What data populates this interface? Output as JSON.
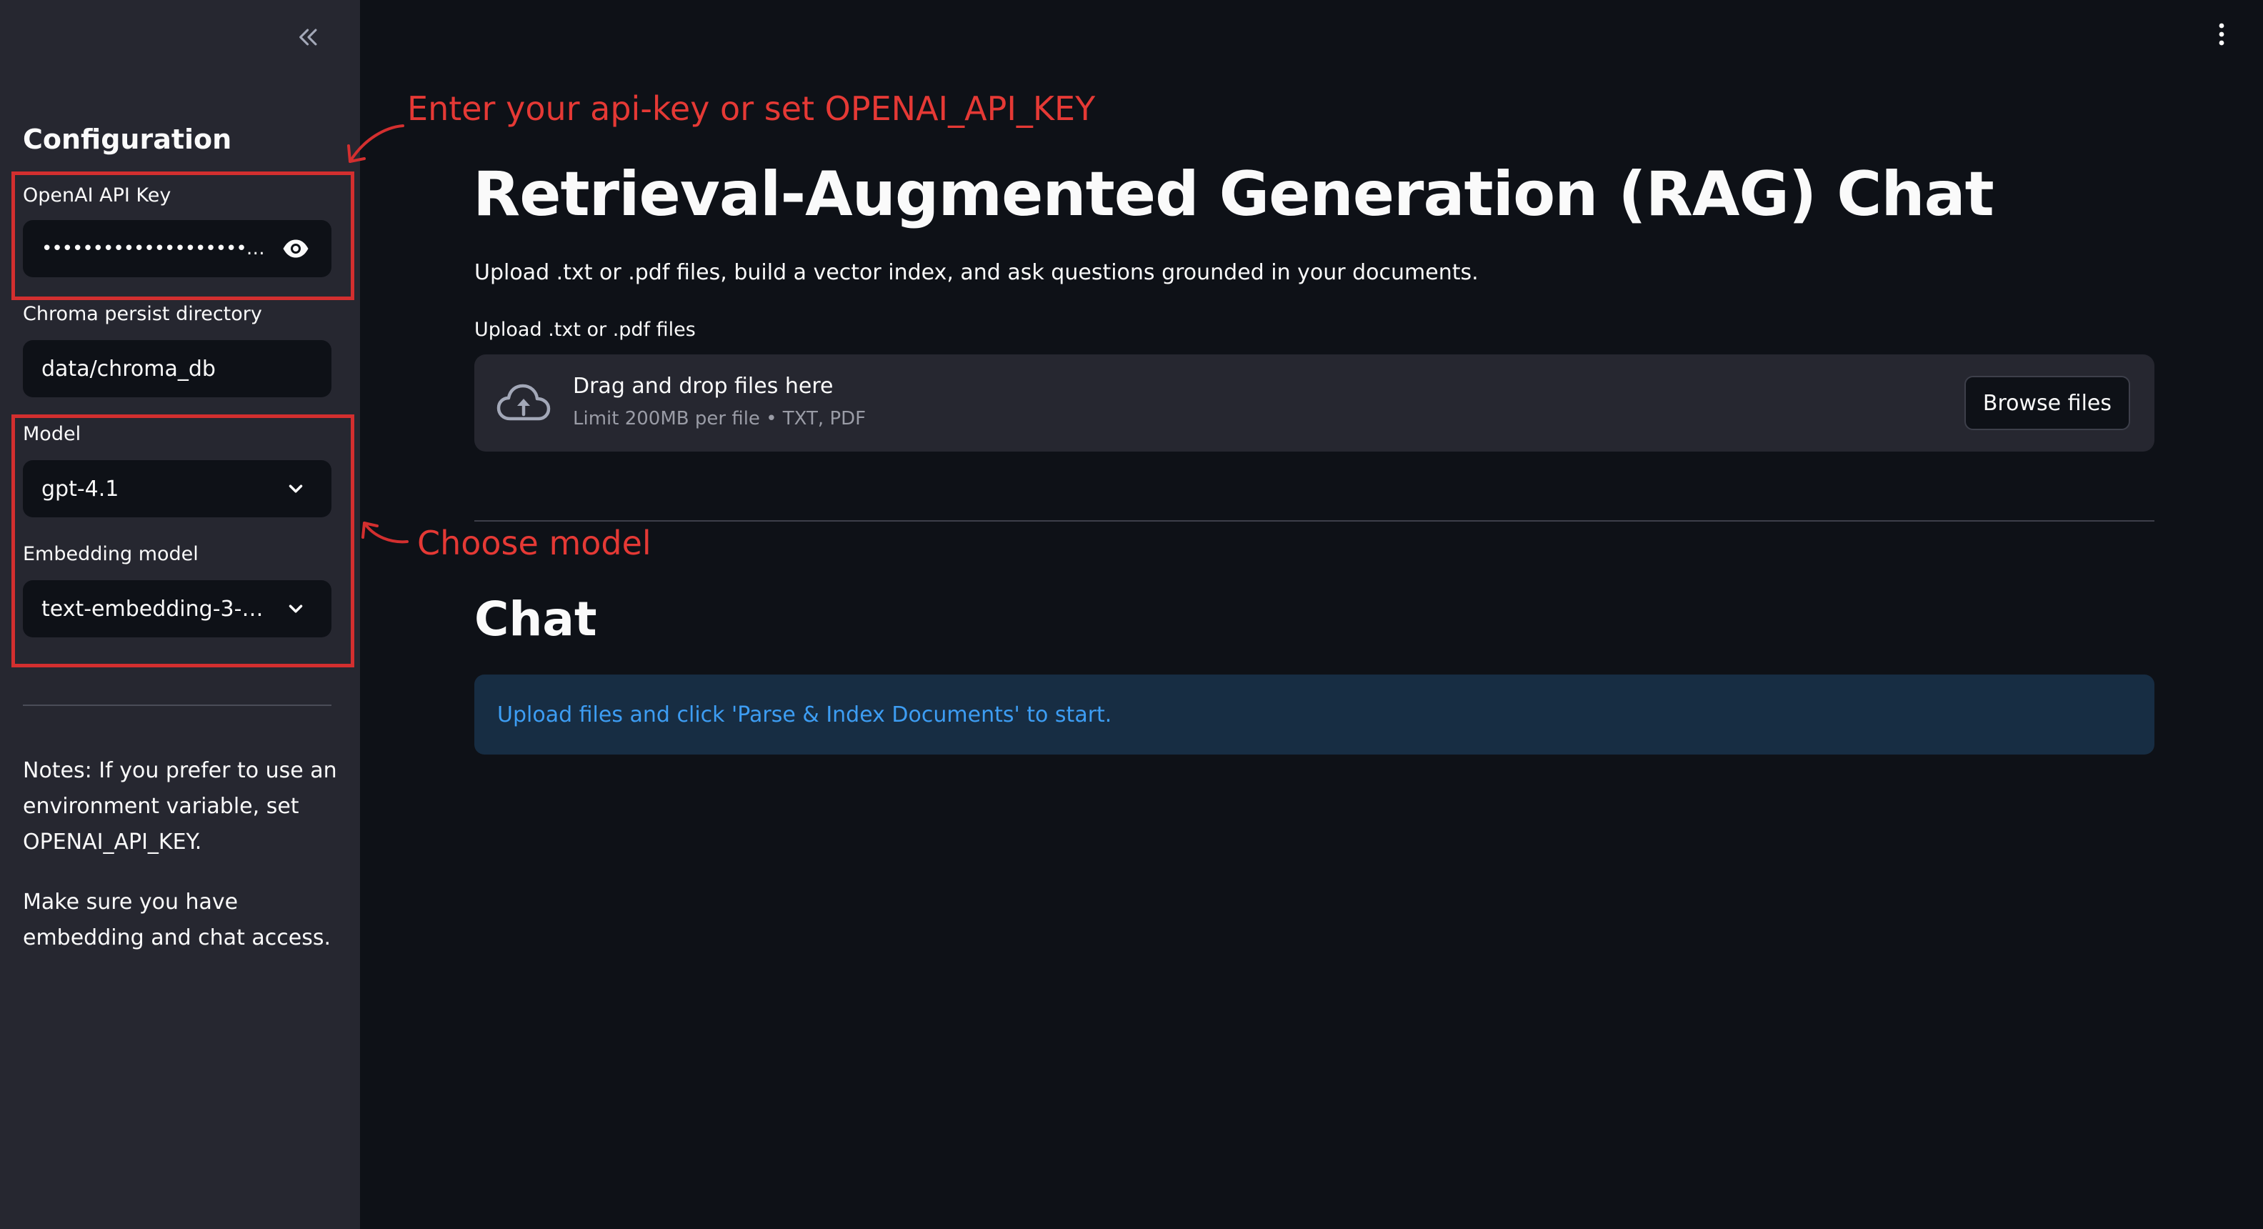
{
  "sidebar": {
    "title": "Configuration",
    "api_key": {
      "label": "OpenAI API Key",
      "value": "••••••••••••••••••••••••"
    },
    "chroma": {
      "label": "Chroma persist directory",
      "value": "data/chroma_db"
    },
    "model": {
      "label": "Model",
      "value": "gpt-4.1"
    },
    "embedding": {
      "label": "Embedding model",
      "value": "text-embedding-3-s…"
    },
    "notes": [
      "Notes: If you prefer to use an environment variable, set OPENAI_API_KEY.",
      "Make sure you have embedding and chat access."
    ]
  },
  "annotations": {
    "api_key_hint": "Enter your api-key or set  OPENAI_API_KEY",
    "model_hint": "Choose model"
  },
  "main": {
    "title": "Retrieval-Augmented Generation (RAG) Chat",
    "description": "Upload .txt or .pdf files, build a vector index, and ask questions grounded in your documents.",
    "uploader": {
      "label": "Upload .txt or .pdf files",
      "drop_text": "Drag and drop files here",
      "limit_text": "Limit 200MB per file • TXT, PDF",
      "browse_label": "Browse files"
    },
    "chat_heading": "Chat",
    "info_message": "Upload files and click 'Parse & Index Documents' to start."
  },
  "colors": {
    "background": "#0e1117",
    "sidebar": "#262730",
    "annotation": "#d32f2f",
    "info_bg": "#172d43",
    "info_text": "#3d9df3"
  },
  "icons": {
    "collapse": "double-chevron-left-icon",
    "menu": "vertical-dots-icon",
    "show_password": "eye-icon",
    "dropdown": "chevron-down-icon",
    "upload": "cloud-upload-icon"
  }
}
